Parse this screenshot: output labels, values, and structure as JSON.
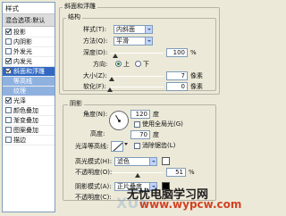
{
  "left_panel": {
    "title": "样式",
    "blend_options": "混合选项:默认",
    "items": [
      {
        "label": "投影",
        "checked": true
      },
      {
        "label": "内阴影",
        "checked": false
      },
      {
        "label": "外发光",
        "checked": false
      },
      {
        "label": "内发光",
        "checked": true
      },
      {
        "label": "斜面和浮雕",
        "checked": true,
        "active": true
      },
      {
        "label": "等高线",
        "checked": false,
        "sub": true
      },
      {
        "label": "纹理",
        "checked": false,
        "sub": true
      },
      {
        "label": "光泽",
        "checked": true
      },
      {
        "label": "颜色叠加",
        "checked": false
      },
      {
        "label": "渐变叠加",
        "checked": false
      },
      {
        "label": "图案叠加",
        "checked": false
      },
      {
        "label": "描边",
        "checked": false
      }
    ]
  },
  "bevel": {
    "group_title": "斜面和浮雕",
    "structure_title": "结构",
    "style_label": "样式(T):",
    "style_value": "内斜面",
    "technique_label": "方法(Q):",
    "technique_value": "平滑",
    "depth_label": "深度(D):",
    "depth_value": "100",
    "depth_unit": "%",
    "depth_level": 0.1,
    "direction_label": "方向:",
    "direction_up": "上",
    "direction_down": "下",
    "size_label": "大小(Z):",
    "size_value": "7",
    "size_unit": "像素",
    "size_level": 0.03,
    "soften_label": "软化(F):",
    "soften_value": "0",
    "soften_unit": "像素",
    "soften_level": 0.0
  },
  "shading": {
    "title": "阴影",
    "angle_label": "角度(N):",
    "angle_value": "120",
    "angle_unit": "度",
    "global_light_label": "使用全局光(G)",
    "global_light_checked": false,
    "altitude_label": "高度:",
    "altitude_value": "70",
    "altitude_unit": "度",
    "gloss_label": "光泽等高线:",
    "antialias_label": "消除锯齿(L)",
    "antialias_checked": false,
    "highlight_mode_label": "高光模式(H):",
    "highlight_mode_value": "滤色",
    "highlight_color": "#ffffff",
    "highlight_opacity_label": "不透明度(O):",
    "highlight_opacity_value": "51",
    "highlight_opacity_unit": "%",
    "highlight_opacity_level": 0.51,
    "shadow_mode_label": "阴影模式(A):",
    "shadow_mode_value": "正片叠底",
    "shadow_color": "#000000",
    "shadow_opacity_label": "不透明度(C):"
  },
  "watermark": {
    "line1": "无忧电脑学习网",
    "line2": "www.wypcw.com",
    "faint": "XUe"
  }
}
